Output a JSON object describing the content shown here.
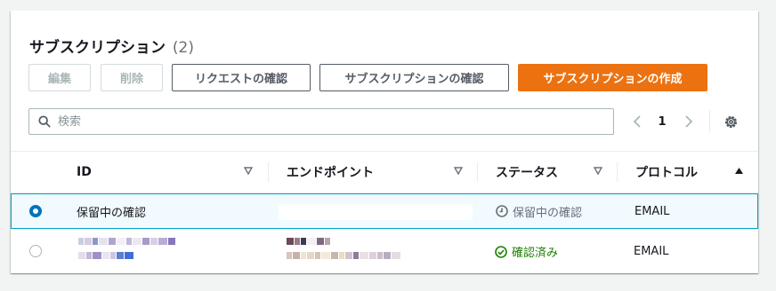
{
  "header": {
    "title": "サブスクリプション",
    "count": "(2)"
  },
  "toolbar": {
    "edit_label": "編集",
    "delete_label": "削除",
    "request_confirm_label": "リクエストの確認",
    "confirm_subscription_label": "サブスクリプションの確認",
    "create_subscription_label": "サブスクリプションの作成"
  },
  "search": {
    "placeholder": "検索",
    "value": ""
  },
  "pagination": {
    "current_page": "1"
  },
  "table": {
    "columns": [
      {
        "label": "ID",
        "sort": "none"
      },
      {
        "label": "エンドポイント",
        "sort": "none"
      },
      {
        "label": "ステータス",
        "sort": "none"
      },
      {
        "label": "プロトコル",
        "sort": "ascending"
      }
    ],
    "rows": [
      {
        "selected": true,
        "id": "保留中の確認",
        "endpoint": "",
        "status": "保留中の確認",
        "status_icon": "clock-icon",
        "protocol": "EMAIL"
      },
      {
        "selected": false,
        "id": "",
        "endpoint": "",
        "status": "確認済み",
        "status_icon": "check-circle-icon",
        "protocol": "EMAIL"
      }
    ]
  },
  "colors": {
    "primary": "#ec7211",
    "selected_border": "#00a1c9",
    "radio": "#0073bb",
    "success": "#1d8102",
    "pending": "#687078"
  }
}
